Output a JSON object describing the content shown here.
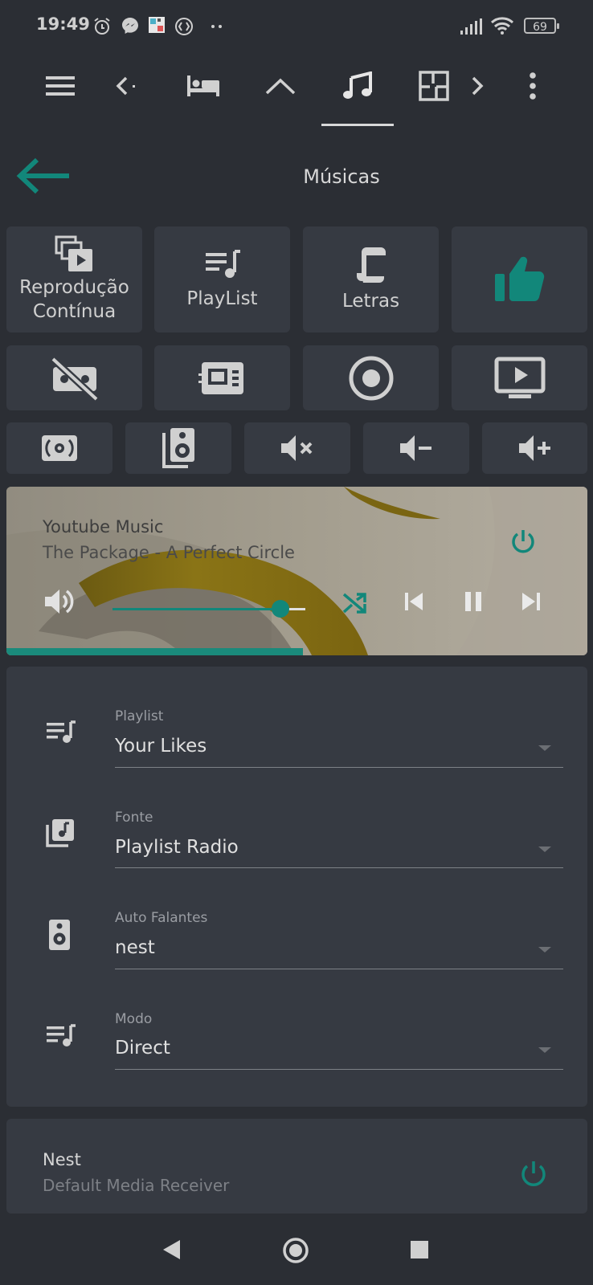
{
  "status_bar": {
    "time": "19:49",
    "battery": "69"
  },
  "page": {
    "title": "Músicas"
  },
  "tiles_row1": [
    {
      "label_line1": "Reprodução",
      "label_line2": "Contínua",
      "icon": "repeat-playback-icon"
    },
    {
      "label": "PlayList",
      "icon": "playlist-icon"
    },
    {
      "label": "Letras",
      "icon": "lyrics-icon"
    },
    {
      "label": "",
      "icon": "thumbs-up-icon"
    }
  ],
  "player": {
    "source": "Youtube Music",
    "track": "The Package - A Perfect Circle",
    "volume_fraction": 0.87,
    "progress_fraction": 0.51
  },
  "fields": [
    {
      "label": "Playlist",
      "value": "Your Likes"
    },
    {
      "label": "Fonte",
      "value": "Playlist Radio"
    },
    {
      "label": "Auto Falantes",
      "value": "nest"
    },
    {
      "label": "Modo",
      "value": "Direct"
    }
  ],
  "device": {
    "name": "Nest",
    "subtitle": "Default Media Receiver"
  },
  "colors": {
    "accent": "#12877a",
    "background": "#2b2e34",
    "card": "#363a42"
  }
}
